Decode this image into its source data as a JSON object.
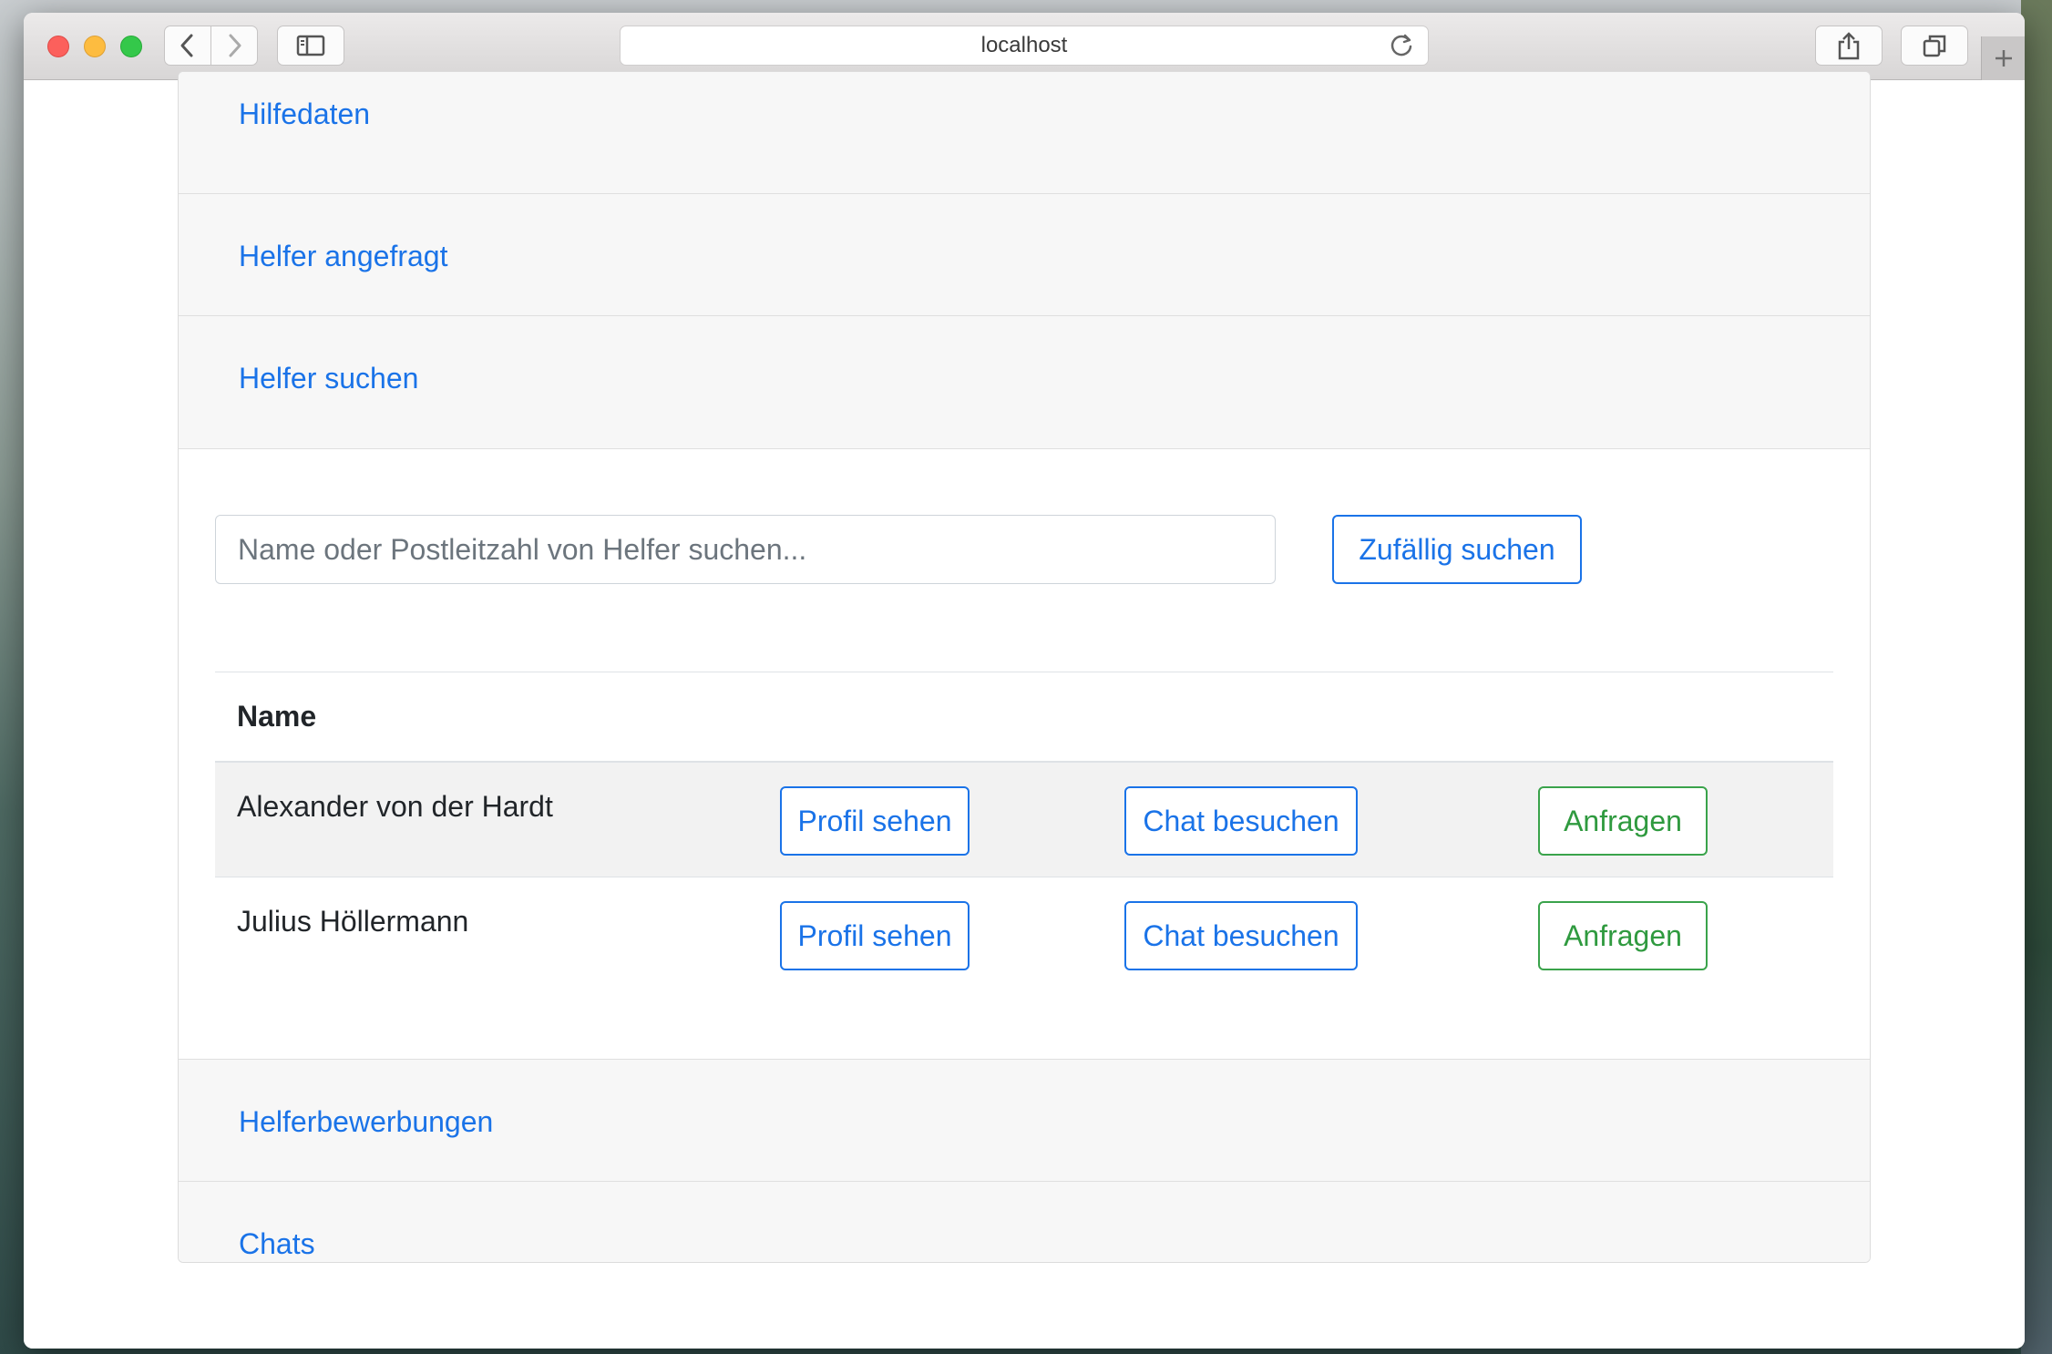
{
  "browser": {
    "url": "localhost"
  },
  "accordion": {
    "items": [
      {
        "label": "Hilfedaten"
      },
      {
        "label": "Helfer angefragt"
      },
      {
        "label": "Helfer suchen"
      },
      {
        "label": "Helferbewerbungen"
      },
      {
        "label": "Chats"
      }
    ]
  },
  "search": {
    "placeholder": "Name oder Postleitzahl von Helfer suchen...",
    "value": "",
    "random_button": "Zufällig suchen"
  },
  "table": {
    "columns": [
      "Name"
    ],
    "rows": [
      {
        "name": "Alexander von der Hardt",
        "profile": "Profil sehen",
        "chat": "Chat besuchen",
        "request": "Anfragen"
      },
      {
        "name": "Julius Höllermann",
        "profile": "Profil sehen",
        "chat": "Chat besuchen",
        "request": "Anfragen"
      }
    ]
  },
  "colors": {
    "link": "#1a73e8",
    "success": "#2f9a3f"
  },
  "icons": {
    "back": "chevron-left-icon",
    "forward": "chevron-right-icon",
    "sidebar": "sidebar-icon",
    "reload": "reload-icon",
    "share": "share-icon",
    "tabs": "tabs-icon",
    "new_tab": "plus-icon"
  }
}
